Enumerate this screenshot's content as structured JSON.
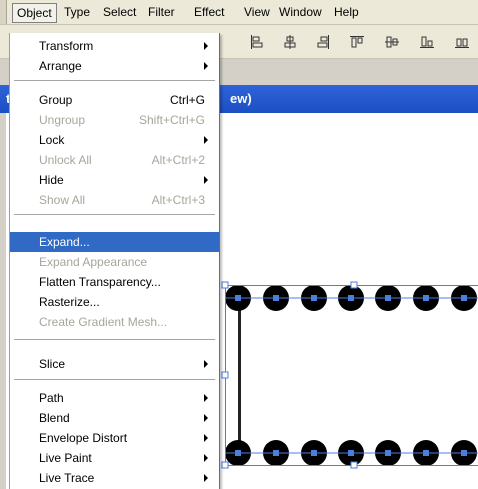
{
  "menubar": {
    "items": [
      {
        "label": "Object",
        "active": true
      },
      {
        "label": "Type"
      },
      {
        "label": "Select"
      },
      {
        "label": "Filter"
      },
      {
        "label": "Effect"
      },
      {
        "label": "View"
      },
      {
        "label": "Window"
      },
      {
        "label": "Help"
      }
    ]
  },
  "document": {
    "title_fragment": "ew)",
    "title_stub": "t"
  },
  "object_menu": {
    "items": [
      {
        "label": "Transform",
        "submenu": true
      },
      {
        "label": "Arrange",
        "submenu": true
      },
      {
        "label": "Group",
        "shortcut": "Ctrl+G"
      },
      {
        "label": "Ungroup",
        "shortcut": "Shift+Ctrl+G",
        "disabled": true
      },
      {
        "label": "Lock",
        "submenu": true
      },
      {
        "label": "Unlock All",
        "shortcut": "Alt+Ctrl+2",
        "disabled": true
      },
      {
        "label": "Hide",
        "submenu": true
      },
      {
        "label": "Show All",
        "shortcut": "Alt+Ctrl+3",
        "disabled": true
      },
      {
        "label": "Expand...",
        "highlighted": true
      },
      {
        "label": "Expand Appearance",
        "disabled": true
      },
      {
        "label": "Flatten Transparency..."
      },
      {
        "label": "Rasterize..."
      },
      {
        "label": "Create Gradient Mesh...",
        "disabled": true
      },
      {
        "label": "Slice",
        "submenu": true
      },
      {
        "label": "Path",
        "submenu": true
      },
      {
        "label": "Blend",
        "submenu": true
      },
      {
        "label": "Envelope Distort",
        "submenu": true
      },
      {
        "label": "Live Paint",
        "submenu": true
      },
      {
        "label": "Live Trace",
        "submenu": true
      }
    ]
  },
  "colors": {
    "highlight": "#316ac5",
    "disabled_text": "#a7a69a",
    "title_bar": "#1c4ec4",
    "selection": "#4a7fe0"
  }
}
